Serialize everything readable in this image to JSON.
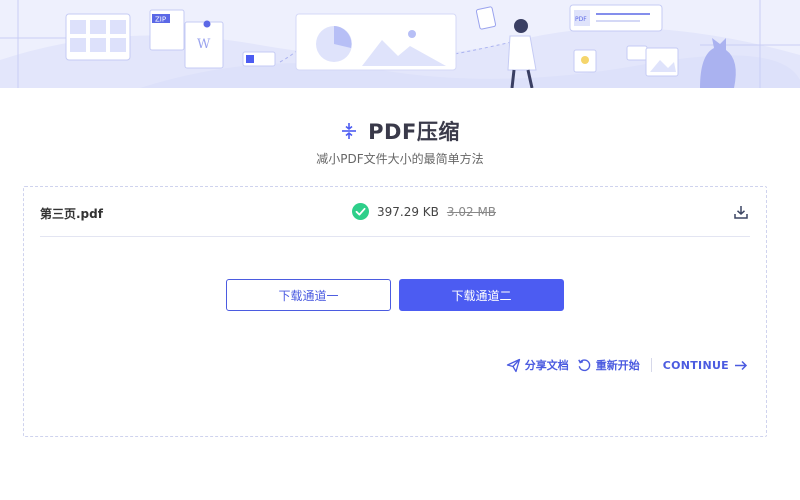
{
  "header": {
    "title": "PDF压缩",
    "subtitle": "减小PDF文件大小的最简单方法",
    "title_icon": "compress-icon",
    "banner_labels": {
      "zip": "ZIP",
      "word": "W",
      "pdf": "PDF"
    }
  },
  "file": {
    "name": "第三页.pdf",
    "compressed_size": "397.29 KB",
    "original_size": "3.02 MB",
    "status_icon": "check-circle-icon",
    "download_icon": "download-icon"
  },
  "buttons": {
    "channel_one": "下载通道一",
    "channel_two": "下载通道二"
  },
  "actions": {
    "share": "分享文档",
    "restart": "重新开始",
    "continue": "CONTINUE"
  },
  "colors": {
    "accent": "#4c5cf2",
    "success": "#2ecf8a",
    "banner_bg": "#eef0fd"
  }
}
